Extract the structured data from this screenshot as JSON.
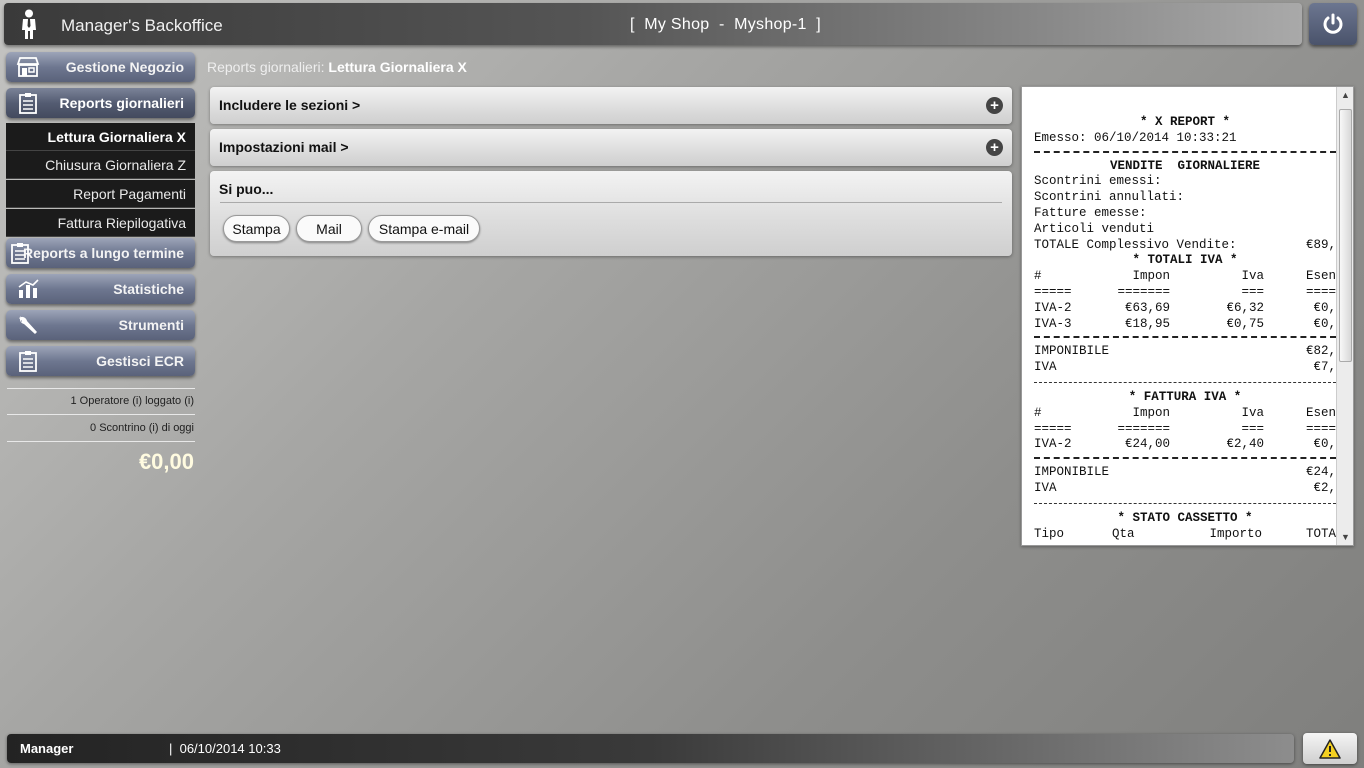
{
  "header": {
    "app_title": "Manager's Backoffice",
    "shop_title": "[  My Shop  -  Myshop-1  ]"
  },
  "sidebar": {
    "items": [
      {
        "label": "Gestione Negozio",
        "icon": "store-icon"
      },
      {
        "label": "Reports giornalieri",
        "icon": "clipboard-icon"
      },
      {
        "label": "Reports a lungo termine",
        "icon": "clipboard-icon"
      },
      {
        "label": "Statistiche",
        "icon": "chart-icon"
      },
      {
        "label": "Strumenti",
        "icon": "wrench-icon"
      },
      {
        "label": "Gestisci ECR",
        "icon": "clipboard-icon"
      }
    ],
    "subitems": [
      {
        "label": "Lettura Giornaliera X"
      },
      {
        "label": "Chiusura Giornaliera Z"
      },
      {
        "label": "Report Pagamenti"
      },
      {
        "label": "Fattura Riepilogativa"
      }
    ],
    "operators_logged": "1 Operatore (i) loggato (i)",
    "receipts_today": "0 Scontrino (i) di oggi",
    "total": "€0,00"
  },
  "breadcrumb": {
    "parent": "Reports giornalieri:",
    "current": "Lettura Giornaliera X"
  },
  "panels": {
    "include_sections": "Includere le sezioni >",
    "mail_settings": "Impostazioni mail >",
    "actions_title": "Si puo...",
    "buttons": {
      "print": "Stampa",
      "mail": "Mail",
      "print_email": "Stampa e-mail"
    }
  },
  "receipt": {
    "title": "* X REPORT *",
    "issued_label": "Emesso:",
    "issued_value": "06/10/2014 10:33:21",
    "sales_header": "VENDITE  GIORNALIERE",
    "lines": [
      "Scontrini emessi:",
      "Scontrini annullati:",
      "Fatture emesse:",
      "Articoli venduti"
    ],
    "total_sales_label": "TOTALE Complessivo Vendite:",
    "total_sales_value": "€89,",
    "vat_totals_header": "* TOTALI IVA *",
    "vat_cols": [
      "#",
      "Impon",
      "Iva",
      "Esen"
    ],
    "vat_underline": [
      "=====",
      "=======",
      "===",
      "===="
    ],
    "vat_rows": [
      [
        "IVA-2",
        "€63,69",
        "€6,32",
        "€0,"
      ],
      [
        "IVA-3",
        "€18,95",
        "€0,75",
        "€0,"
      ]
    ],
    "taxable_label": "IMPONIBILE",
    "taxable_value": "€82,",
    "iva_label": "IVA",
    "iva_value": "€7,",
    "invoice_vat_header": "* FATTURA IVA *",
    "invoice_rows": [
      [
        "IVA-2",
        "€24,00",
        "€2,40",
        "€0,"
      ]
    ],
    "invoice_taxable_value": "€24,",
    "invoice_iva_value": "€2,",
    "drawer_header": "* STATO CASSETTO *",
    "drawer_cols": [
      "Tipo",
      "Qta",
      "Importo",
      "TOTA"
    ]
  },
  "statusbar": {
    "user": "Manager",
    "datetime": "|  06/10/2014 10:33"
  },
  "colors": {
    "nav_button": "#6e7790",
    "topbar_dark": "#3a3a3a",
    "total_text": "#fffbe0"
  }
}
